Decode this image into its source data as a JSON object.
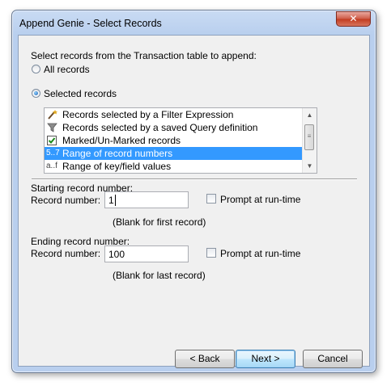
{
  "window": {
    "title": "Append Genie - Select Records",
    "close_glyph": "✕"
  },
  "instruction": "Select records from the Transaction table to append:",
  "radio_all": {
    "label": "All records",
    "selected": false
  },
  "radio_selected": {
    "label": "Selected records",
    "selected": true
  },
  "list": {
    "items": [
      {
        "icon": "wand",
        "label": "Records selected by a Filter Expression",
        "selected": false
      },
      {
        "icon": "funnel",
        "label": "Records selected by a saved Query definition",
        "selected": false
      },
      {
        "icon": "checkmark",
        "label": "Marked/Un-Marked records",
        "selected": false
      },
      {
        "icon": "5..7",
        "label": "Range of record numbers",
        "selected": true
      },
      {
        "icon": "a..f",
        "label": "Range of key/field values",
        "selected": false
      }
    ]
  },
  "starting": {
    "heading": "Starting record number:",
    "field_label": "Record number:",
    "value": "1",
    "hint": "(Blank for first record)",
    "prompt_label": "Prompt at run-time"
  },
  "ending": {
    "heading": "Ending record number:",
    "field_label": "Record number:",
    "value": "100",
    "hint": "(Blank for last record)",
    "prompt_label": "Prompt at run-time"
  },
  "buttons": {
    "back": "< Back",
    "next": "Next >",
    "cancel": "Cancel"
  }
}
